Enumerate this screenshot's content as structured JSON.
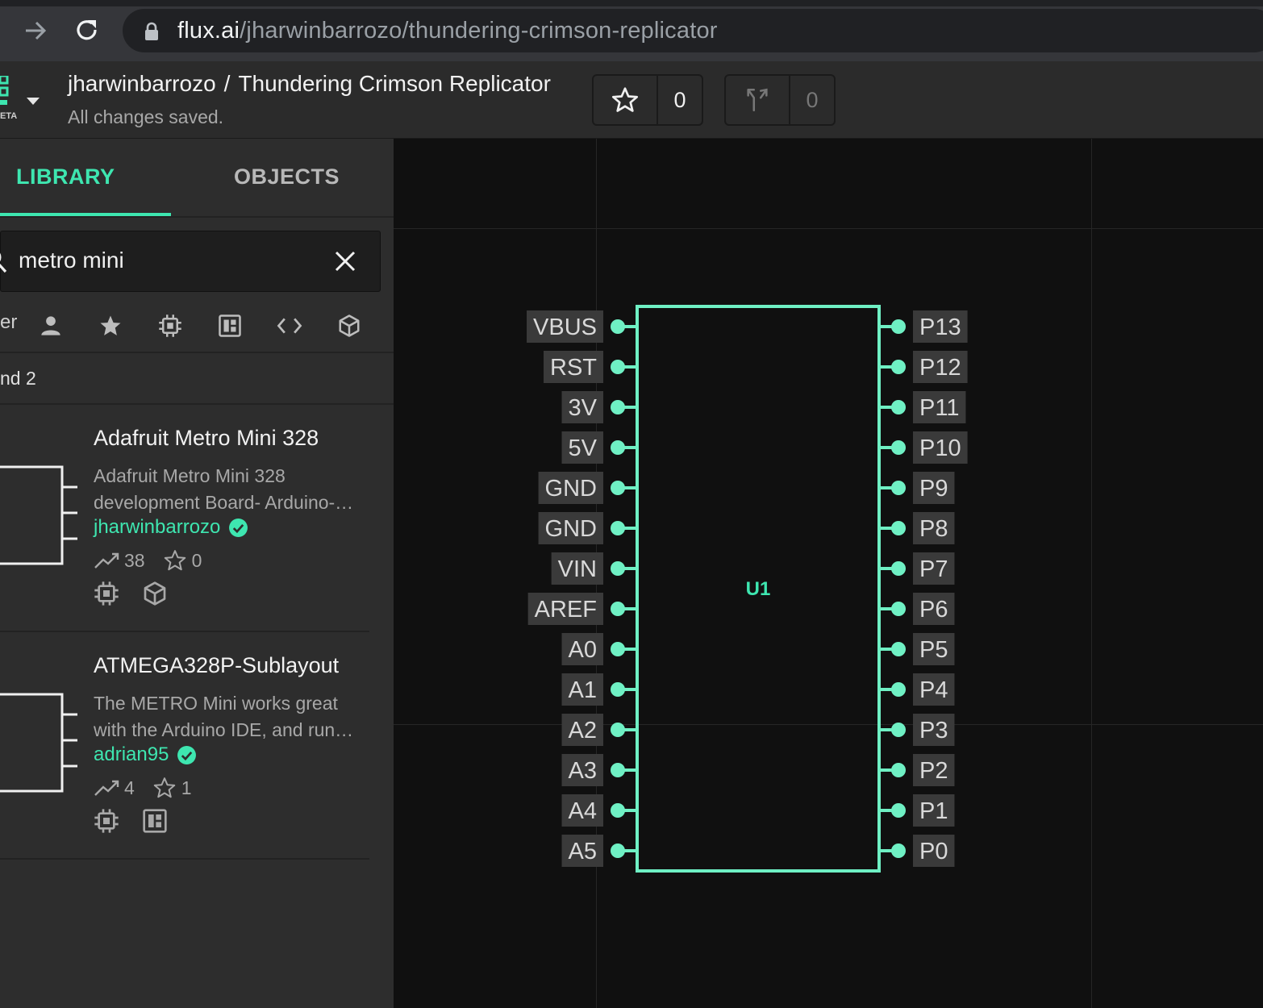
{
  "browser": {
    "url_domain": "flux.ai",
    "url_path": "/jharwinbarrozo/thundering-crimson-replicator"
  },
  "header": {
    "logo_badge": "ETA",
    "owner": "jharwinbarrozo",
    "separator": "/",
    "project_name": "Thundering Crimson Replicator",
    "save_status": "All changes saved.",
    "star_count": "0",
    "fork_count": "0"
  },
  "sidebar": {
    "tabs": [
      {
        "label": "LIBRARY",
        "active": true
      },
      {
        "label": "OBJECTS",
        "active": false
      }
    ],
    "search": {
      "value": "metro mini"
    },
    "filter_label": "er",
    "filters": [
      "user-icon",
      "star-icon",
      "chip-icon",
      "module-icon",
      "code-icon",
      "cube-icon"
    ],
    "result_count": "nd 2",
    "results": [
      {
        "title": "Adafruit Metro Mini 328",
        "description_lines": [
          "Adafruit Metro Mini 328",
          "development Board- Arduino-…"
        ],
        "author": "jharwinbarrozo",
        "uses": "38",
        "stars": "0",
        "types": [
          "chip-icon",
          "cube-icon"
        ]
      },
      {
        "title": "ATMEGA328P-Sublayout",
        "description_lines": [
          "The METRO Mini works great",
          "with the Arduino IDE, and run…"
        ],
        "author": "adrian95",
        "uses": "4",
        "stars": "1",
        "types": [
          "chip-icon",
          "module-icon"
        ]
      }
    ]
  },
  "schematic": {
    "designator": "U1",
    "left_pins": [
      "VBUS",
      "RST",
      "3V",
      "5V",
      "GND",
      "GND",
      "VIN",
      "AREF",
      "A0",
      "A1",
      "A2",
      "A3",
      "A4",
      "A5"
    ],
    "right_pins": [
      "P13",
      "P12",
      "P11",
      "P10",
      "P9",
      "P8",
      "P7",
      "P6",
      "P5",
      "P4",
      "P3",
      "P2",
      "P1",
      "P0"
    ],
    "accent_color": "#6ff0c4",
    "label_bg": "#3a3a3a"
  }
}
